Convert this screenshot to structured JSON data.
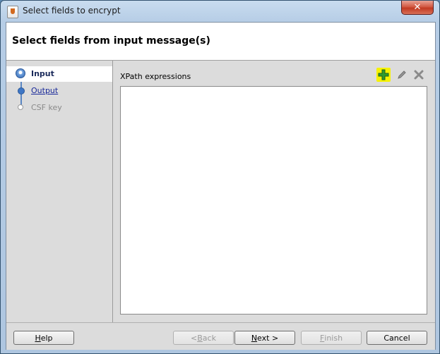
{
  "window": {
    "title": "Select fields to encrypt",
    "close_glyph": "✕"
  },
  "header": {
    "title": "Select fields from input message(s)"
  },
  "nav": {
    "items": [
      {
        "label": "Input",
        "state": "active"
      },
      {
        "label": "Output",
        "state": "link"
      },
      {
        "label": "CSF key",
        "state": "disabled"
      }
    ]
  },
  "content": {
    "section_label": "XPath expressions",
    "toolbar": {
      "add_icon": "plus-icon",
      "edit_icon": "pencil-icon",
      "delete_icon": "x-icon",
      "accent": "#f6f200"
    }
  },
  "footer": {
    "help": {
      "mn": "H",
      "rest": "elp"
    },
    "back": {
      "pre": "< ",
      "mn": "B",
      "rest": "ack"
    },
    "next": {
      "mn": "N",
      "rest": "ext >"
    },
    "finish": {
      "mn": "F",
      "rest": "inish"
    },
    "cancel": "Cancel"
  }
}
